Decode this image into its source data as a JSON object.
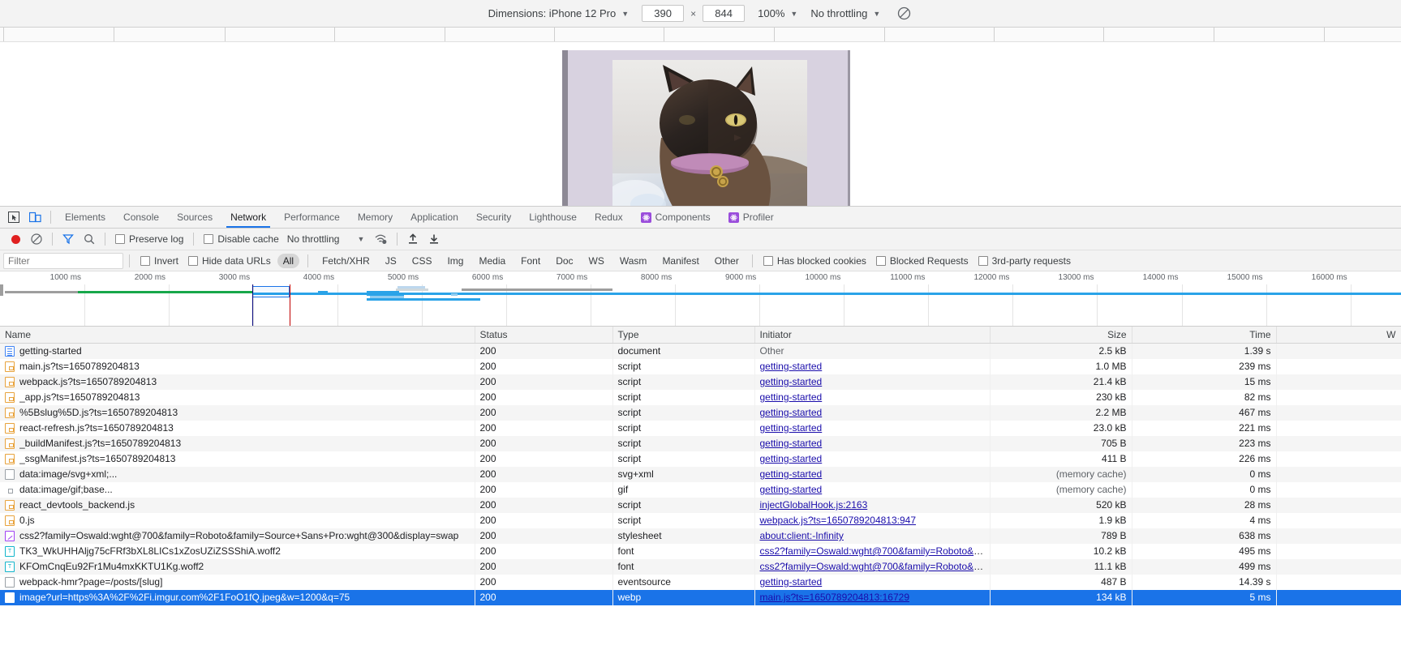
{
  "device_toolbar": {
    "dimensions_label": "Dimensions: iPhone 12 Pro",
    "dimensions_caret": "▼",
    "width_value": "390",
    "times": "×",
    "height_value": "844",
    "zoom_label": "100%",
    "zoom_caret": "▼",
    "throttling_label": "No throttling",
    "throttling_caret": "▼",
    "rotate_icon": "rotate-icon"
  },
  "devtools_tabs": {
    "inspect_icon": "inspect-element-icon",
    "device_toggle_icon": "device-toolbar-icon",
    "items": [
      {
        "label": "Elements",
        "active": false,
        "icon": null
      },
      {
        "label": "Console",
        "active": false,
        "icon": null
      },
      {
        "label": "Sources",
        "active": false,
        "icon": null
      },
      {
        "label": "Network",
        "active": true,
        "icon": null
      },
      {
        "label": "Performance",
        "active": false,
        "icon": null
      },
      {
        "label": "Memory",
        "active": false,
        "icon": null
      },
      {
        "label": "Application",
        "active": false,
        "icon": null
      },
      {
        "label": "Security",
        "active": false,
        "icon": null
      },
      {
        "label": "Lighthouse",
        "active": false,
        "icon": null
      },
      {
        "label": "Redux",
        "active": false,
        "icon": null
      },
      {
        "label": "Components",
        "active": false,
        "icon": "react-icon"
      },
      {
        "label": "Profiler",
        "active": false,
        "icon": "react-icon"
      }
    ]
  },
  "network_toolbar": {
    "record_icon": "record-stop-icon",
    "clear_icon": "clear-icon",
    "filter_icon": "filter-funnel-icon",
    "search_icon": "search-icon",
    "preserve_log_label": "Preserve log",
    "preserve_log_checked": false,
    "disable_cache_label": "Disable cache",
    "disable_cache_checked": false,
    "throttling_label": "No throttling",
    "throttling_caret": "▼",
    "wifi_icon": "network-conditions-icon",
    "import_icon": "import-har-icon",
    "export_icon": "export-har-icon"
  },
  "filter_row": {
    "filter_placeholder": "Filter",
    "filter_value": "",
    "invert_label": "Invert",
    "invert_checked": false,
    "hide_data_urls_label": "Hide data URLs",
    "hide_data_urls_checked": false,
    "types": [
      {
        "label": "All",
        "active": true
      },
      {
        "label": "Fetch/XHR",
        "active": false
      },
      {
        "label": "JS",
        "active": false
      },
      {
        "label": "CSS",
        "active": false
      },
      {
        "label": "Img",
        "active": false
      },
      {
        "label": "Media",
        "active": false
      },
      {
        "label": "Font",
        "active": false
      },
      {
        "label": "Doc",
        "active": false
      },
      {
        "label": "WS",
        "active": false
      },
      {
        "label": "Wasm",
        "active": false
      },
      {
        "label": "Manifest",
        "active": false
      },
      {
        "label": "Other",
        "active": false
      }
    ],
    "has_blocked_cookies_label": "Has blocked cookies",
    "has_blocked_cookies_checked": false,
    "blocked_requests_label": "Blocked Requests",
    "blocked_requests_checked": false,
    "third_party_label": "3rd-party requests",
    "third_party_checked": false
  },
  "overview": {
    "tick_labels": [
      "1000 ms",
      "2000 ms",
      "3000 ms",
      "4000 ms",
      "5000 ms",
      "6000 ms",
      "7000 ms",
      "8000 ms",
      "9000 ms",
      "10000 ms",
      "11000 ms",
      "12000 ms",
      "13000 ms",
      "14000 ms",
      "15000 ms",
      "16000 ms"
    ],
    "dcl_marker_color": "#0a0a80",
    "load_marker_color": "#c00000",
    "selection_color": "#1a73e8"
  },
  "table": {
    "columns": [
      "Name",
      "Status",
      "Type",
      "Initiator",
      "Size",
      "Time",
      "W"
    ],
    "rows": [
      {
        "icon": "doc",
        "name": "getting-started",
        "status": "200",
        "type": "document",
        "initiator": "Other",
        "initiator_link": false,
        "size": "2.5 kB",
        "time": "1.39 s",
        "selected": false
      },
      {
        "icon": "js",
        "name": "main.js?ts=1650789204813",
        "status": "200",
        "type": "script",
        "initiator": "getting-started",
        "initiator_link": true,
        "size": "1.0 MB",
        "time": "239 ms",
        "selected": false
      },
      {
        "icon": "js",
        "name": "webpack.js?ts=1650789204813",
        "status": "200",
        "type": "script",
        "initiator": "getting-started",
        "initiator_link": true,
        "size": "21.4 kB",
        "time": "15 ms",
        "selected": false
      },
      {
        "icon": "js",
        "name": "_app.js?ts=1650789204813",
        "status": "200",
        "type": "script",
        "initiator": "getting-started",
        "initiator_link": true,
        "size": "230 kB",
        "time": "82 ms",
        "selected": false
      },
      {
        "icon": "js",
        "name": "%5Bslug%5D.js?ts=1650789204813",
        "status": "200",
        "type": "script",
        "initiator": "getting-started",
        "initiator_link": true,
        "size": "2.2 MB",
        "time": "467 ms",
        "selected": false
      },
      {
        "icon": "js",
        "name": "react-refresh.js?ts=1650789204813",
        "status": "200",
        "type": "script",
        "initiator": "getting-started",
        "initiator_link": true,
        "size": "23.0 kB",
        "time": "221 ms",
        "selected": false
      },
      {
        "icon": "js",
        "name": "_buildManifest.js?ts=1650789204813",
        "status": "200",
        "type": "script",
        "initiator": "getting-started",
        "initiator_link": true,
        "size": "705 B",
        "time": "223 ms",
        "selected": false
      },
      {
        "icon": "js",
        "name": "_ssgManifest.js?ts=1650789204813",
        "status": "200",
        "type": "script",
        "initiator": "getting-started",
        "initiator_link": true,
        "size": "411 B",
        "time": "226 ms",
        "selected": false
      },
      {
        "icon": "plain",
        "name": "data:image/svg+xml;...",
        "status": "200",
        "type": "svg+xml",
        "initiator": "getting-started",
        "initiator_link": true,
        "size": "(memory cache)",
        "time": "0 ms",
        "selected": false
      },
      {
        "icon": "tiny",
        "name": "data:image/gif;base...",
        "status": "200",
        "type": "gif",
        "initiator": "getting-started",
        "initiator_link": true,
        "size": "(memory cache)",
        "time": "0 ms",
        "selected": false
      },
      {
        "icon": "js",
        "name": "react_devtools_backend.js",
        "status": "200",
        "type": "script",
        "initiator": "injectGlobalHook.js:2163",
        "initiator_link": true,
        "size": "520 kB",
        "time": "28 ms",
        "selected": false
      },
      {
        "icon": "js",
        "name": "0.js",
        "status": "200",
        "type": "script",
        "initiator": "webpack.js?ts=1650789204813:947",
        "initiator_link": true,
        "size": "1.9 kB",
        "time": "4 ms",
        "selected": false
      },
      {
        "icon": "css",
        "name": "css2?family=Oswald:wght@700&family=Roboto&family=Source+Sans+Pro:wght@300&display=swap",
        "status": "200",
        "type": "stylesheet",
        "initiator": "about:client:-Infinity",
        "initiator_link": true,
        "size": "789 B",
        "time": "638 ms",
        "selected": false
      },
      {
        "icon": "font",
        "name": "TK3_WkUHHAljg75cFRf3bXL8LICs1xZosUZiZSSShiA.woff2",
        "status": "200",
        "type": "font",
        "initiator": "css2?family=Oswald:wght@700&family=Roboto&family...",
        "initiator_link": true,
        "size": "10.2 kB",
        "time": "495 ms",
        "selected": false
      },
      {
        "icon": "font",
        "name": "KFOmCnqEu92Fr1Mu4mxKKTU1Kg.woff2",
        "status": "200",
        "type": "font",
        "initiator": "css2?family=Oswald:wght@700&family=Roboto&family...",
        "initiator_link": true,
        "size": "11.1 kB",
        "time": "499 ms",
        "selected": false
      },
      {
        "icon": "plain",
        "name": "webpack-hmr?page=/posts/[slug]",
        "status": "200",
        "type": "eventsource",
        "initiator": "getting-started",
        "initiator_link": true,
        "size": "487 B",
        "time": "14.39 s",
        "selected": false
      },
      {
        "icon": "img",
        "name": "image?url=https%3A%2F%2Fi.imgur.com%2F1FoO1fQ.jpeg&w=1200&q=75",
        "status": "200",
        "type": "webp",
        "initiator": "main.js?ts=1650789204813:16729",
        "initiator_link": true,
        "size": "134 kB",
        "time": "5 ms",
        "selected": true
      }
    ]
  }
}
